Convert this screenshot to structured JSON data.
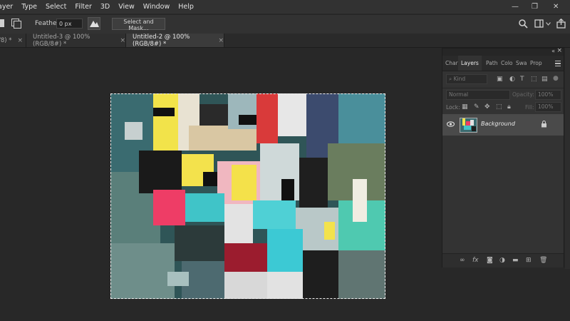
{
  "menubar": {
    "items": [
      "ayer",
      "Type",
      "Select",
      "Filter",
      "3D",
      "View",
      "Window",
      "Help"
    ],
    "controls": {
      "minimize": "—",
      "restore": "❐",
      "close": "✕"
    }
  },
  "options": {
    "feather_label": "Feather:",
    "feather_value": "0 px",
    "select_mask_label": "Select and Mask..."
  },
  "tabs": [
    {
      "label": "/8) *"
    },
    {
      "label": "Untitled-3 @ 100% (RGB/8#) *"
    },
    {
      "label": "Untitled-2 @ 100% (RGB/8#) *",
      "active": true
    }
  ],
  "tab_close": "×",
  "layers_panel": {
    "tabs": [
      "Char",
      "Layers",
      "Path",
      "Colo",
      "Swa",
      "Prop"
    ],
    "filter_placeholder": "Kind",
    "blend_mode": "Normal",
    "opacity_label": "Opacity:",
    "opacity_value": "100%",
    "lock_label": "Lock:",
    "fill_label": "Fill:",
    "fill_value": "100%",
    "layer": {
      "name": "Background",
      "visible": true,
      "locked": true
    }
  },
  "colors": {
    "accent": "#3b3b3b",
    "panel": "#333333",
    "canvas_bg": "#282828"
  }
}
